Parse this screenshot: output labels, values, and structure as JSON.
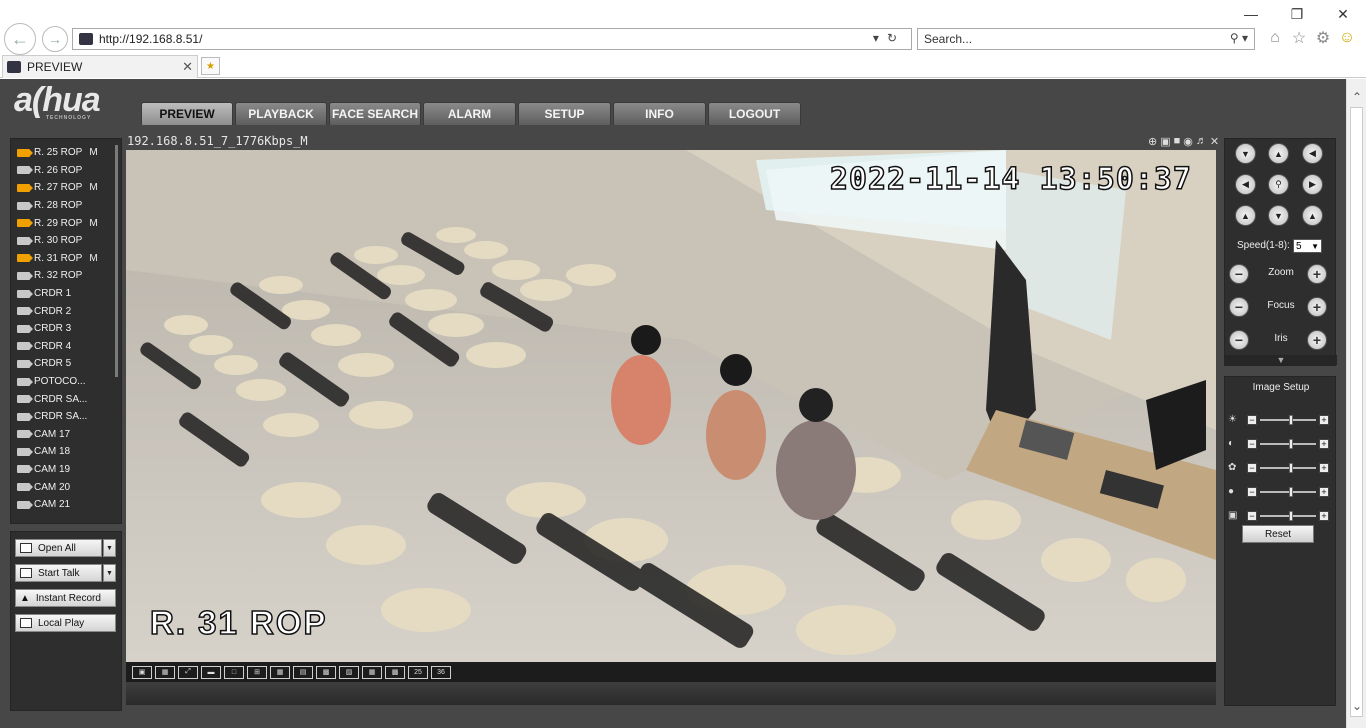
{
  "browser": {
    "address": "http://192.168.8.51/",
    "search_placeholder": "Search...",
    "tab_title": "PREVIEW"
  },
  "app": {
    "logo_text": "a(hua",
    "logo_sub": "TECHNOLOGY",
    "menu": [
      "PREVIEW",
      "PLAYBACK",
      "FACE SEARCH",
      "ALARM",
      "SETUP",
      "INFO",
      "LOGOUT"
    ],
    "active_menu": "PREVIEW",
    "cameras": [
      {
        "name": "R. 25 ROP",
        "stream": "M",
        "live": true
      },
      {
        "name": "R. 26 ROP",
        "stream": "",
        "live": false
      },
      {
        "name": "R. 27 ROP",
        "stream": "M",
        "live": true
      },
      {
        "name": "R. 28 ROP",
        "stream": "",
        "live": false
      },
      {
        "name": "R. 29 ROP",
        "stream": "M",
        "live": true
      },
      {
        "name": "R. 30 ROP",
        "stream": "",
        "live": false
      },
      {
        "name": "R. 31 ROP",
        "stream": "M",
        "live": true
      },
      {
        "name": "R. 32 ROP",
        "stream": "",
        "live": false
      },
      {
        "name": "CRDR 1",
        "stream": "",
        "live": false
      },
      {
        "name": "CRDR 2",
        "stream": "",
        "live": false
      },
      {
        "name": "CRDR 3",
        "stream": "",
        "live": false
      },
      {
        "name": "CRDR 4",
        "stream": "",
        "live": false
      },
      {
        "name": "CRDR 5",
        "stream": "",
        "live": false
      },
      {
        "name": "POTOCO...",
        "stream": "",
        "live": false
      },
      {
        "name": "CRDR SA...",
        "stream": "",
        "live": false
      },
      {
        "name": "CRDR SA...",
        "stream": "",
        "live": false
      },
      {
        "name": "CAM 17",
        "stream": "",
        "live": false
      },
      {
        "name": "CAM 18",
        "stream": "",
        "live": false
      },
      {
        "name": "CAM 19",
        "stream": "",
        "live": false
      },
      {
        "name": "CAM 20",
        "stream": "",
        "live": false
      },
      {
        "name": "CAM 21",
        "stream": "",
        "live": false
      }
    ],
    "buttons": {
      "open_all": "Open All",
      "start_talk": "Start Talk",
      "instant_record": "Instant Record",
      "local_play": "Local Play"
    },
    "video": {
      "stream_title": "192.168.8.51_7_1776Kbps_M",
      "osd_time": "2022-11-14 13:50:37",
      "osd_name": "R. 31 ROP"
    },
    "layout_buttons": [
      "1",
      "2",
      "4",
      "6",
      "8",
      "9",
      "13",
      "16",
      "20",
      "25",
      "36"
    ],
    "layout_labels": {
      "25": "25",
      "36": "36"
    },
    "ptz": {
      "speed_label": "Speed(1-8):",
      "speed_value": "5",
      "zoom_label": "Zoom",
      "focus_label": "Focus",
      "iris_label": "Iris"
    },
    "image_setup": {
      "title": "Image Setup",
      "reset_label": "Reset",
      "sliders": [
        {
          "icon": "brightness-icon",
          "level": 0.55
        },
        {
          "icon": "contrast-icon",
          "level": 0.55
        },
        {
          "icon": "saturation-icon",
          "level": 0.55
        },
        {
          "icon": "hue-icon",
          "level": 0.55
        },
        {
          "icon": "sharpness-icon",
          "level": 0.55
        }
      ]
    },
    "colors": {
      "accent_live": "#f0a000",
      "panel_bg": "#474747"
    }
  }
}
